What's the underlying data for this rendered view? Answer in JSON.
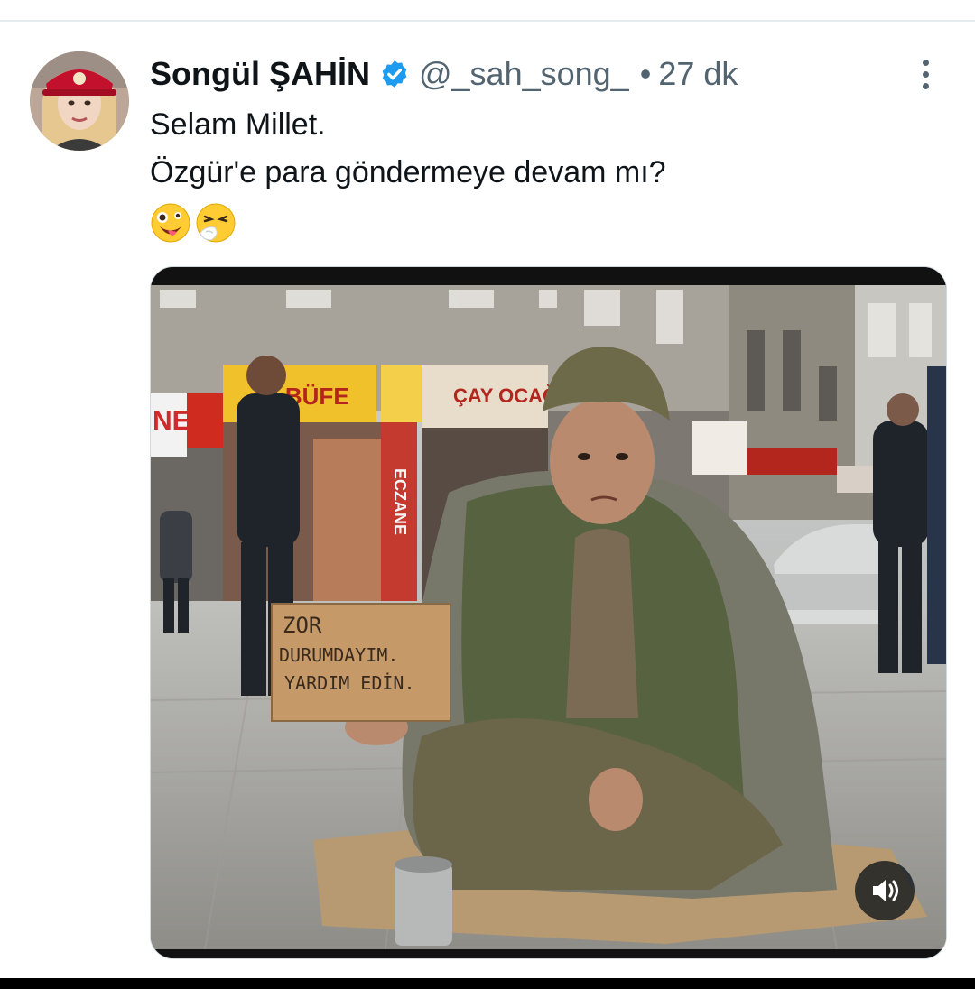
{
  "tweet": {
    "author": {
      "display_name": "Songül ŞAHİN",
      "handle": "@_sah_song_",
      "verified": true
    },
    "separator": "•",
    "timestamp": "27 dk",
    "text_lines": [
      "Selam Millet.",
      "Özgür'e para göndermeye devam mı?"
    ],
    "emojis": [
      "zany-face-icon",
      "sneezing-face-icon"
    ],
    "media": {
      "sign_text": [
        "ZOR",
        "DURUMDAYIM.",
        "YARDIM EDİN."
      ],
      "storefront_signs": [
        "NE",
        "M BÜFE",
        "ÇAY OCAĞI",
        "ECZANE"
      ],
      "volume_icon": "volume-icon"
    }
  },
  "colors": {
    "verified_badge": "#1d9bf0",
    "secondary_text": "#536471",
    "primary_text": "#0f1419"
  }
}
